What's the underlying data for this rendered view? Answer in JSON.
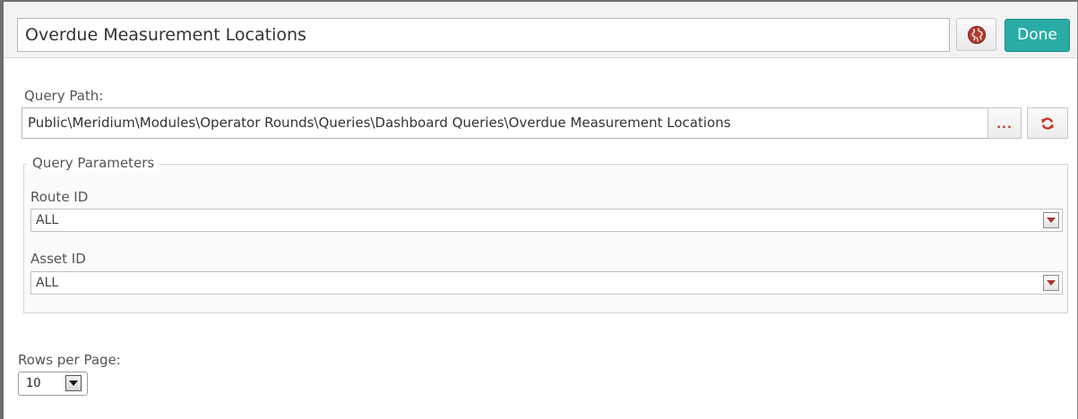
{
  "header": {
    "title_value": "Overdue Measurement Locations",
    "globe_icon": "globe-icon",
    "done_label": "Done"
  },
  "query_path": {
    "label": "Query Path:",
    "value": "Public\\Meridium\\Modules\\Operator Rounds\\Queries\\Dashboard Queries\\Overdue Measurement Locations",
    "browse_label": "...",
    "refresh_icon": "refresh-icon"
  },
  "query_parameters": {
    "legend": "Query Parameters",
    "route_id": {
      "label": "Route ID",
      "value": "ALL"
    },
    "asset_id": {
      "label": "Asset ID",
      "value": "ALL"
    }
  },
  "rows_per_page": {
    "label": "Rows per Page:",
    "value": "10"
  },
  "colors": {
    "done_button": "#2aaca6",
    "accent_red": "#c0392b",
    "header_bg": "#f3f3f3"
  }
}
